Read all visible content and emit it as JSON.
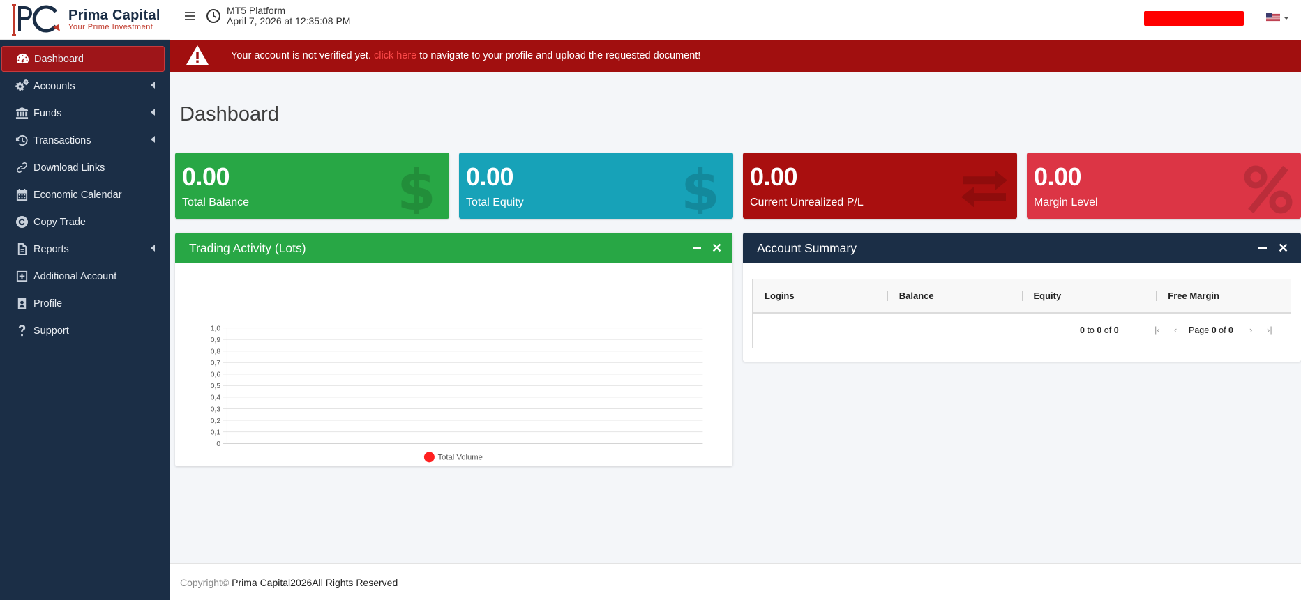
{
  "brand": {
    "name": "Prima Capital",
    "tagline": "Your Prime Investment",
    "logo_letters": "PC"
  },
  "sidebar": {
    "items": [
      {
        "label": "Dashboard",
        "icon": "tachometer-icon",
        "active": true,
        "has_children": false
      },
      {
        "label": "Accounts",
        "icon": "cogs-icon",
        "has_children": true
      },
      {
        "label": "Funds",
        "icon": "bank-icon",
        "has_children": true
      },
      {
        "label": "Transactions",
        "icon": "history-icon",
        "has_children": true
      },
      {
        "label": "Download Links",
        "icon": "link-icon",
        "has_children": false
      },
      {
        "label": "Economic Calendar",
        "icon": "calendar-icon",
        "has_children": false
      },
      {
        "label": "Copy Trade",
        "icon": "copy-trade-icon",
        "has_children": false
      },
      {
        "label": "Reports",
        "icon": "file-icon",
        "has_children": true
      },
      {
        "label": "Additional Account",
        "icon": "plus-square-icon",
        "has_children": false
      },
      {
        "label": "Profile",
        "icon": "id-card-icon",
        "has_children": false
      },
      {
        "label": "Support",
        "icon": "question-icon",
        "has_children": false
      }
    ]
  },
  "topbar": {
    "platform": "MT5 Platform",
    "datetime": "April 7, 2026 at 12:35:08 PM",
    "language": "en-US"
  },
  "alert": {
    "text_before": "Your account is not verified yet.",
    "link": "click here",
    "text_after": "to navigate to your profile and upload the requested document!"
  },
  "page": {
    "title": "Dashboard"
  },
  "stats": [
    {
      "value": "0.00",
      "label": "Total Balance",
      "icon": "dollar-icon",
      "color": "#28a745"
    },
    {
      "value": "0.00",
      "label": "Total Equity",
      "icon": "dollar-icon",
      "color": "#17a2b8"
    },
    {
      "value": "0.00",
      "label": "Current Unrealized P/L",
      "icon": "exchange-icon",
      "color": "#a90f0f"
    },
    {
      "value": "0.00",
      "label": "Margin Level",
      "icon": "percent-icon",
      "color": "#dc3545"
    }
  ],
  "trading_card": {
    "title": "Trading Activity (Lots)"
  },
  "chart_data": {
    "type": "line",
    "title": "",
    "xlabel": "",
    "ylabel": "",
    "ylim": [
      0,
      1
    ],
    "yticks": [
      "1,0",
      "0,9",
      "0,8",
      "0,7",
      "0,6",
      "0,5",
      "0,4",
      "0,3",
      "0,2",
      "0,1",
      "0"
    ],
    "grid": true,
    "legend_position": "bottom",
    "series": [
      {
        "name": "Total Volume",
        "color": "#ff2020",
        "values": []
      }
    ]
  },
  "account_card": {
    "title": "Account Summary",
    "columns": [
      "Logins",
      "Balance",
      "Equity",
      "Free Margin"
    ],
    "rows": [],
    "pagination": {
      "from": "0",
      "to_word": "to",
      "to": "0",
      "of_word": "of",
      "total": "0",
      "page_word": "Page",
      "page": "0",
      "pages": "0"
    }
  },
  "footer": {
    "copyright": "Copyright©",
    "owner": "Prima Capital2026All Rights Reserved"
  },
  "colors": {
    "sidebar": "#1b2e46",
    "accent_red": "#a10f0f",
    "green": "#28a745",
    "teal": "#17a2b8",
    "pink": "#dc3545"
  }
}
